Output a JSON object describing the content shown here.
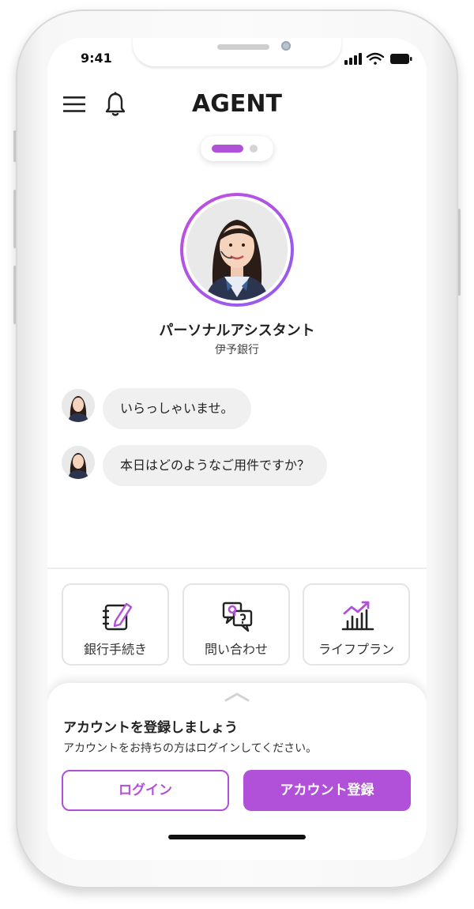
{
  "status_bar": {
    "time": "9:41",
    "signal_icon": "signal-bars-icon",
    "wifi_icon": "wifi-icon",
    "battery_icon": "battery-icon"
  },
  "header": {
    "menu_icon": "hamburger-menu-icon",
    "bell_icon": "bell-icon",
    "logo": "AGENT"
  },
  "pager": {
    "active_index": 0,
    "count": 2
  },
  "assistant": {
    "title": "パーソナルアシスタント",
    "bank": "伊予銀行"
  },
  "messages": [
    {
      "text": "いらっしゃいませ。"
    },
    {
      "text": "本日はどのようなご用件ですか？"
    }
  ],
  "actions": [
    {
      "label": "銀行手続き",
      "icon": "notebook-pen-icon"
    },
    {
      "label": "問い合わせ",
      "icon": "chat-question-icon"
    },
    {
      "label": "ライフプラン",
      "icon": "growth-chart-icon"
    }
  ],
  "sheet": {
    "title": "アカウントを登録しましょう",
    "subtitle": "アカウントをお持ちの方はログインしてください。",
    "login_label": "ログイン",
    "register_label": "アカウント登録"
  },
  "colors": {
    "accent": "#b150d8",
    "accent_gradient_end": "#8f5df2"
  }
}
